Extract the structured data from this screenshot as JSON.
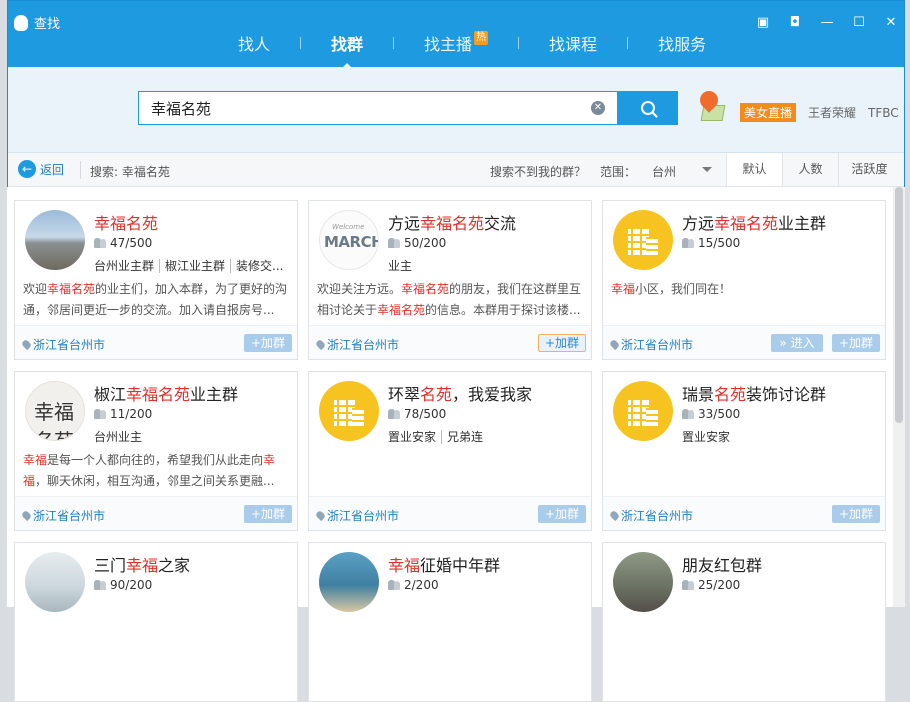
{
  "window": {
    "title": "查找"
  },
  "tabs": [
    {
      "label": "找人",
      "active": false
    },
    {
      "label": "找群",
      "active": true
    },
    {
      "label": "找主播",
      "active": false,
      "badge": "热"
    },
    {
      "label": "找课程",
      "active": false
    },
    {
      "label": "找服务",
      "active": false
    }
  ],
  "window_controls": [
    "feedback-icon",
    "skin-icon",
    "minimize-icon",
    "maximize-icon",
    "close-icon"
  ],
  "search": {
    "value": "幸福名苑",
    "button_icon": "search-icon"
  },
  "hot_links": {
    "live_badge": "美女直播",
    "link1": "王者荣耀",
    "link2": "TFBC"
  },
  "toolbar": {
    "back": "返回",
    "crumb": "搜索: 幸福名苑",
    "cant_find": "搜索不到我的群？",
    "range_label": "范围：",
    "range_value": "台州",
    "sorts": [
      "默认",
      "人数",
      "活跃度"
    ],
    "active_sort": "默认"
  },
  "colors": {
    "accent": "#1e9be0",
    "highlight": "#e0312b",
    "badge": "#f28c1b"
  },
  "cards": [
    {
      "title_pre": "",
      "title_hl": "幸福名苑",
      "title_post": "",
      "members": "47/500",
      "tags": [
        "台州业主群",
        "椒江业主群",
        "装修交..."
      ],
      "desc_parts": [
        "欢迎",
        "幸福名苑",
        "的业主们，加入本群，为了更好的沟通，邻居间更近一步的交流。加入请自报房号..."
      ],
      "location": "浙江省台州市",
      "join": "+加群",
      "avatar": "photo"
    },
    {
      "title_pre": "方远",
      "title_hl": "幸福名苑",
      "title_post": "交流",
      "members": "50/200",
      "tags": [
        "业主"
      ],
      "desc_parts": [
        "欢迎关注方远。",
        "幸福名苑",
        "的朋友，我们在这群里互相讨论关于",
        "幸福名苑",
        "的信息。本群用于探讨该楼..."
      ],
      "location": "浙江省台州市",
      "join": "+加群",
      "avatar": "march",
      "avatar_text": "MARCH",
      "avatar_small": "Welcome"
    },
    {
      "title_pre": "方远",
      "title_hl": "幸福名苑",
      "title_post": "业主群",
      "members": "15/500",
      "tags": [],
      "desc_parts": [
        "",
        "幸福",
        "小区，我们同在！"
      ],
      "location": "浙江省台州市",
      "enter": "» 进入",
      "join": "+加群",
      "avatar": "building"
    },
    {
      "title_pre": "椒江",
      "title_hl": "幸福名苑",
      "title_post": "业主群",
      "members": "11/200",
      "tags": [
        "台州业主"
      ],
      "desc_parts": [
        "",
        "幸福",
        "是每一个人都向往的，希望我们从此走向",
        "幸福",
        "，聊天休闲，相互沟通，邻里之间关系更融..."
      ],
      "location": "浙江省台州市",
      "join": "+加群",
      "avatar": "calli",
      "avatar_text": "幸福名苑"
    },
    {
      "title_pre": "环翠",
      "title_hl": "名苑",
      "title_post": "，我爱我家",
      "members": "78/500",
      "tags": [
        "置业安家",
        "兄弟连"
      ],
      "desc_parts": [],
      "location": "浙江省台州市",
      "join": "+加群",
      "avatar": "building"
    },
    {
      "title_pre": "瑞景",
      "title_hl": "名苑",
      "title_post": "装饰讨论群",
      "members": "33/500",
      "tags": [
        "置业安家"
      ],
      "desc_parts": [],
      "location": "浙江省台州市",
      "join": "+加群",
      "avatar": "building"
    },
    {
      "title_pre": "三门",
      "title_hl": "幸福",
      "title_post": "之家",
      "members": "90/200",
      "tags": [],
      "desc_parts": [],
      "location": "",
      "join": "",
      "avatar": "mist"
    },
    {
      "title_pre": "",
      "title_hl": "幸福",
      "title_post": "征婚中年群",
      "members": "2/200",
      "tags": [],
      "desc_parts": [],
      "location": "",
      "join": "",
      "avatar": "sea"
    },
    {
      "title_pre": "朋友红包群",
      "title_hl": "",
      "title_post": "",
      "members": "25/200",
      "tags": [],
      "desc_parts": [],
      "location": "",
      "join": "",
      "avatar": "street"
    }
  ]
}
